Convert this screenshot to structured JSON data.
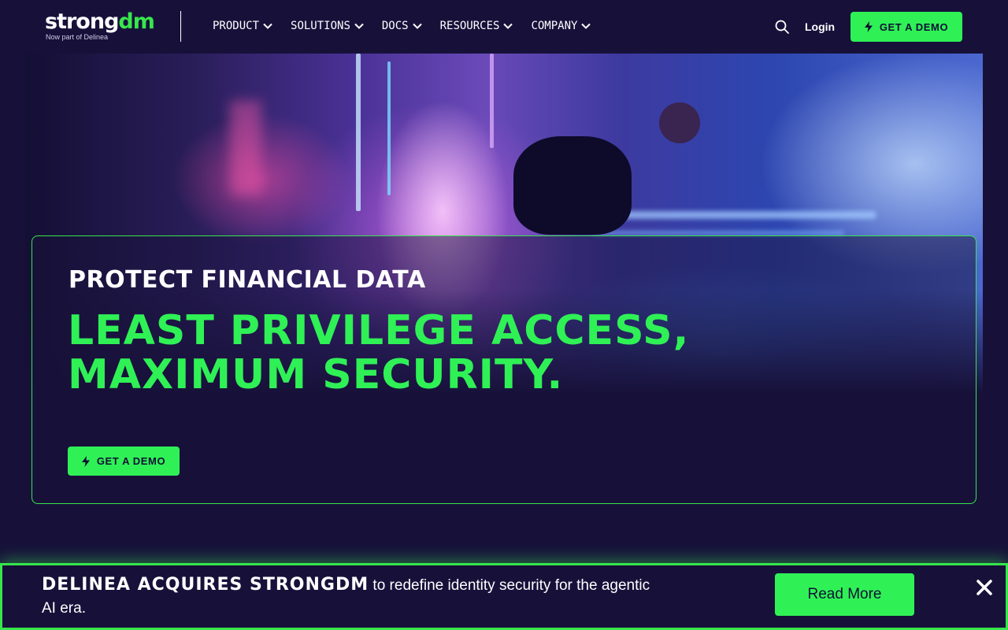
{
  "header": {
    "logo": {
      "part1": "strong",
      "part2": "dm",
      "subtitle": "Now part of Delinea"
    },
    "nav": [
      {
        "label": "PRODUCT"
      },
      {
        "label": "SOLUTIONS"
      },
      {
        "label": "DOCS"
      },
      {
        "label": "RESOURCES"
      },
      {
        "label": "COMPANY"
      }
    ],
    "login_label": "Login",
    "demo_label": "GET A DEMO"
  },
  "hero": {
    "eyebrow": "PROTECT FINANCIAL DATA",
    "headline_line1": "LEAST PRIVILEGE ACCESS,",
    "headline_line2": "MAXIMUM SECURITY.",
    "cta_label": "GET A DEMO"
  },
  "banner": {
    "headline": "DELINEA ACQUIRES STRONGDM",
    "body": " to redefine identity security for the agentic AI era.",
    "button_label": "Read More"
  },
  "icons": {
    "search": "search-icon",
    "chevron": "chevron-down-icon",
    "bolt": "bolt-icon",
    "close": "close-icon"
  },
  "colors": {
    "background": "#17113a",
    "accent_green": "#2ff156",
    "button_text": "#101035",
    "white": "#ffffff"
  }
}
